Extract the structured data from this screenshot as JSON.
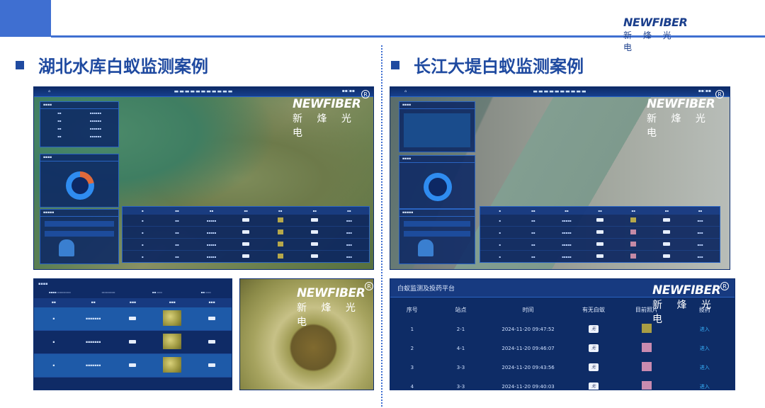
{
  "header": {
    "logo_en": "NEWFIBER",
    "logo_cn": "新 烽 光 电"
  },
  "left_section": {
    "title": "湖北水库白蚁监测案例"
  },
  "right_section": {
    "title": "长江大堤白蚁监测案例"
  },
  "overlay_logo": {
    "en": "NEWFIBER",
    "cn": "新 烽 光 电",
    "reg": "R"
  },
  "zoom_table": {
    "title": "白蚁监测及投药平台",
    "columns": [
      "序号",
      "站点",
      "时间",
      "有无白蚁",
      "目前照片",
      "投药"
    ],
    "rows": [
      {
        "no": "1",
        "site": "2-1",
        "time": "2024-11-20 09:47:52",
        "flag": "无",
        "photo": "yellow",
        "action": "进入"
      },
      {
        "no": "2",
        "site": "4-1",
        "time": "2024-11-20 09:46:07",
        "flag": "无",
        "photo": "pink",
        "action": "进入"
      },
      {
        "no": "3",
        "site": "3-3",
        "time": "2024-11-20 09:43:56",
        "flag": "无",
        "photo": "pink",
        "action": "进入"
      },
      {
        "no": "4",
        "site": "3-3",
        "time": "2024-11-20 09:40:03",
        "flag": "无",
        "photo": "pink",
        "action": "进入"
      }
    ]
  }
}
